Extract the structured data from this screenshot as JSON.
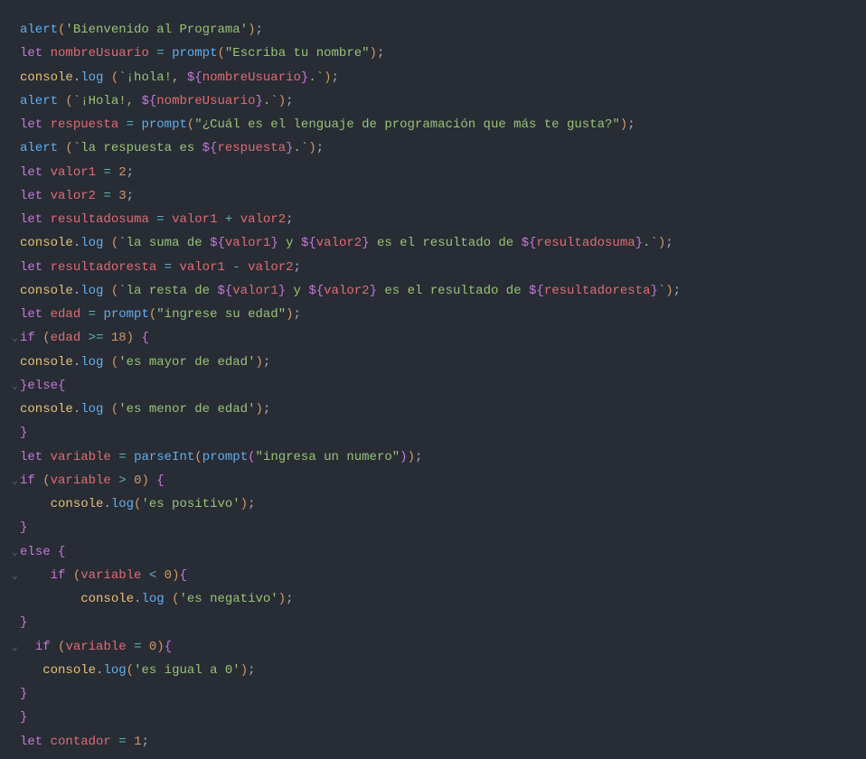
{
  "lines": [
    {
      "fold": "",
      "tokens": [
        [
          "fn",
          "alert"
        ],
        [
          "paren1",
          "("
        ],
        [
          "str",
          "'Bienvenido al Programa'"
        ],
        [
          "paren1",
          ")"
        ],
        [
          "punc",
          ";"
        ]
      ]
    },
    {
      "fold": "",
      "tokens": [
        [
          "kw",
          "let"
        ],
        [
          "default",
          " "
        ],
        [
          "var",
          "nombreUsuario"
        ],
        [
          "default",
          " "
        ],
        [
          "op",
          "="
        ],
        [
          "default",
          " "
        ],
        [
          "fn",
          "prompt"
        ],
        [
          "paren1",
          "("
        ],
        [
          "str",
          "\"Escriba tu nombre\""
        ],
        [
          "paren1",
          ")"
        ],
        [
          "punc",
          ";"
        ]
      ]
    },
    {
      "fold": "",
      "tokens": [
        [
          "obj",
          "console"
        ],
        [
          "punc",
          "."
        ],
        [
          "fn",
          "log"
        ],
        [
          "default",
          " "
        ],
        [
          "paren1",
          "("
        ],
        [
          "tpl",
          "`¡hola!, "
        ],
        [
          "brace",
          "${"
        ],
        [
          "int",
          "nombreUsuario"
        ],
        [
          "brace",
          "}"
        ],
        [
          "tpl",
          ".`"
        ],
        [
          "paren1",
          ")"
        ],
        [
          "punc",
          ";"
        ]
      ]
    },
    {
      "fold": "",
      "tokens": [
        [
          "fn",
          "alert"
        ],
        [
          "default",
          " "
        ],
        [
          "paren1",
          "("
        ],
        [
          "tpl",
          "`¡Hola!, "
        ],
        [
          "brace",
          "${"
        ],
        [
          "int",
          "nombreUsuario"
        ],
        [
          "brace",
          "}"
        ],
        [
          "tpl",
          ".`"
        ],
        [
          "paren1",
          ")"
        ],
        [
          "punc",
          ";"
        ]
      ]
    },
    {
      "fold": "",
      "tokens": [
        [
          "kw",
          "let"
        ],
        [
          "default",
          " "
        ],
        [
          "var",
          "respuesta"
        ],
        [
          "default",
          " "
        ],
        [
          "op",
          "="
        ],
        [
          "default",
          " "
        ],
        [
          "fn",
          "prompt"
        ],
        [
          "paren1",
          "("
        ],
        [
          "str",
          "\"¿Cuál es el lenguaje de programación que más te gusta?\""
        ],
        [
          "paren1",
          ")"
        ],
        [
          "punc",
          ";"
        ]
      ]
    },
    {
      "fold": "",
      "tokens": [
        [
          "fn",
          "alert"
        ],
        [
          "default",
          " "
        ],
        [
          "paren1",
          "("
        ],
        [
          "tpl",
          "`la respuesta es "
        ],
        [
          "brace",
          "${"
        ],
        [
          "int",
          "respuesta"
        ],
        [
          "brace",
          "}"
        ],
        [
          "tpl",
          ".`"
        ],
        [
          "paren1",
          ")"
        ],
        [
          "punc",
          ";"
        ]
      ]
    },
    {
      "fold": "",
      "tokens": [
        [
          "kw",
          "let"
        ],
        [
          "default",
          " "
        ],
        [
          "var",
          "valor1"
        ],
        [
          "default",
          " "
        ],
        [
          "op",
          "="
        ],
        [
          "default",
          " "
        ],
        [
          "num",
          "2"
        ],
        [
          "punc",
          ";"
        ]
      ]
    },
    {
      "fold": "",
      "tokens": [
        [
          "kw",
          "let"
        ],
        [
          "default",
          " "
        ],
        [
          "var",
          "valor2"
        ],
        [
          "default",
          " "
        ],
        [
          "op",
          "="
        ],
        [
          "default",
          " "
        ],
        [
          "num",
          "3"
        ],
        [
          "punc",
          ";"
        ]
      ]
    },
    {
      "fold": "",
      "tokens": [
        [
          "kw",
          "let"
        ],
        [
          "default",
          " "
        ],
        [
          "var",
          "resultadosuma"
        ],
        [
          "default",
          " "
        ],
        [
          "op",
          "="
        ],
        [
          "default",
          " "
        ],
        [
          "var",
          "valor1"
        ],
        [
          "default",
          " "
        ],
        [
          "op",
          "+"
        ],
        [
          "default",
          " "
        ],
        [
          "var",
          "valor2"
        ],
        [
          "punc",
          ";"
        ]
      ]
    },
    {
      "fold": "",
      "tokens": [
        [
          "obj",
          "console"
        ],
        [
          "punc",
          "."
        ],
        [
          "fn",
          "log"
        ],
        [
          "default",
          " "
        ],
        [
          "paren1",
          "("
        ],
        [
          "tpl",
          "`la suma de "
        ],
        [
          "brace",
          "${"
        ],
        [
          "int",
          "valor1"
        ],
        [
          "brace",
          "}"
        ],
        [
          "tpl",
          " y "
        ],
        [
          "brace",
          "${"
        ],
        [
          "int",
          "valor2"
        ],
        [
          "brace",
          "}"
        ],
        [
          "tpl",
          " es el resultado de "
        ],
        [
          "brace",
          "${"
        ],
        [
          "int",
          "resultadosuma"
        ],
        [
          "brace",
          "}"
        ],
        [
          "tpl",
          ".`"
        ],
        [
          "paren1",
          ")"
        ],
        [
          "punc",
          ";"
        ]
      ]
    },
    {
      "fold": "",
      "tokens": [
        [
          "kw",
          "let"
        ],
        [
          "default",
          " "
        ],
        [
          "var",
          "resultadoresta"
        ],
        [
          "default",
          " "
        ],
        [
          "op",
          "="
        ],
        [
          "default",
          " "
        ],
        [
          "var",
          "valor1"
        ],
        [
          "default",
          " "
        ],
        [
          "op",
          "-"
        ],
        [
          "default",
          " "
        ],
        [
          "var",
          "valor2"
        ],
        [
          "punc",
          ";"
        ]
      ]
    },
    {
      "fold": "",
      "tokens": [
        [
          "obj",
          "console"
        ],
        [
          "punc",
          "."
        ],
        [
          "fn",
          "log"
        ],
        [
          "default",
          " "
        ],
        [
          "paren1",
          "("
        ],
        [
          "tpl",
          "`la resta de "
        ],
        [
          "brace",
          "${"
        ],
        [
          "int",
          "valor1"
        ],
        [
          "brace",
          "}"
        ],
        [
          "tpl",
          " y "
        ],
        [
          "brace",
          "${"
        ],
        [
          "int",
          "valor2"
        ],
        [
          "brace",
          "}"
        ],
        [
          "tpl",
          " es el resultado de "
        ],
        [
          "brace",
          "${"
        ],
        [
          "int",
          "resultadoresta"
        ],
        [
          "brace",
          "}"
        ],
        [
          "tpl",
          "`"
        ],
        [
          "paren1",
          ")"
        ],
        [
          "punc",
          ";"
        ]
      ]
    },
    {
      "fold": "",
      "tokens": [
        [
          "kw",
          "let"
        ],
        [
          "default",
          " "
        ],
        [
          "var",
          "edad"
        ],
        [
          "default",
          " "
        ],
        [
          "op",
          "="
        ],
        [
          "default",
          " "
        ],
        [
          "fn",
          "prompt"
        ],
        [
          "paren1",
          "("
        ],
        [
          "str",
          "\"ingrese su edad\""
        ],
        [
          "paren1",
          ")"
        ],
        [
          "punc",
          ";"
        ]
      ]
    },
    {
      "fold": "v",
      "tokens": [
        [
          "kw",
          "if"
        ],
        [
          "default",
          " "
        ],
        [
          "paren1",
          "("
        ],
        [
          "var",
          "edad"
        ],
        [
          "default",
          " "
        ],
        [
          "op",
          ">="
        ],
        [
          "default",
          " "
        ],
        [
          "num",
          "18"
        ],
        [
          "paren1",
          ")"
        ],
        [
          "default",
          " "
        ],
        [
          "brace",
          "{"
        ]
      ]
    },
    {
      "fold": "",
      "tokens": [
        [
          "obj",
          "console"
        ],
        [
          "punc",
          "."
        ],
        [
          "fn",
          "log"
        ],
        [
          "default",
          " "
        ],
        [
          "paren1",
          "("
        ],
        [
          "str",
          "'es mayor de edad'"
        ],
        [
          "paren1",
          ")"
        ],
        [
          "punc",
          ";"
        ]
      ]
    },
    {
      "fold": "v",
      "tokens": [
        [
          "brace",
          "}"
        ],
        [
          "kw",
          "else"
        ],
        [
          "brace",
          "{"
        ]
      ]
    },
    {
      "fold": "",
      "tokens": [
        [
          "obj",
          "console"
        ],
        [
          "punc",
          "."
        ],
        [
          "fn",
          "log"
        ],
        [
          "default",
          " "
        ],
        [
          "paren1",
          "("
        ],
        [
          "str",
          "'es menor de edad'"
        ],
        [
          "paren1",
          ")"
        ],
        [
          "punc",
          ";"
        ]
      ]
    },
    {
      "fold": "",
      "tokens": [
        [
          "brace",
          "}"
        ]
      ]
    },
    {
      "fold": "",
      "tokens": [
        [
          "kw",
          "let"
        ],
        [
          "default",
          " "
        ],
        [
          "var",
          "variable"
        ],
        [
          "default",
          " "
        ],
        [
          "op",
          "="
        ],
        [
          "default",
          " "
        ],
        [
          "fn",
          "parseInt"
        ],
        [
          "paren1",
          "("
        ],
        [
          "fn",
          "prompt"
        ],
        [
          "paren2",
          "("
        ],
        [
          "str",
          "\"ingresa un numero\""
        ],
        [
          "paren2",
          ")"
        ],
        [
          "paren1",
          ")"
        ],
        [
          "punc",
          ";"
        ]
      ]
    },
    {
      "fold": "v",
      "tokens": [
        [
          "kw",
          "if"
        ],
        [
          "default",
          " "
        ],
        [
          "paren1",
          "("
        ],
        [
          "var",
          "variable"
        ],
        [
          "default",
          " "
        ],
        [
          "op",
          ">"
        ],
        [
          "default",
          " "
        ],
        [
          "num",
          "0"
        ],
        [
          "paren1",
          ")"
        ],
        [
          "default",
          " "
        ],
        [
          "brace",
          "{"
        ]
      ]
    },
    {
      "fold": "",
      "tokens": [
        [
          "default",
          "    "
        ],
        [
          "obj",
          "console"
        ],
        [
          "punc",
          "."
        ],
        [
          "fn",
          "log"
        ],
        [
          "paren1",
          "("
        ],
        [
          "str",
          "'es positivo'"
        ],
        [
          "paren1",
          ")"
        ],
        [
          "punc",
          ";"
        ]
      ]
    },
    {
      "fold": "",
      "tokens": [
        [
          "brace",
          "}"
        ]
      ]
    },
    {
      "fold": "v",
      "tokens": [
        [
          "kw",
          "else"
        ],
        [
          "default",
          " "
        ],
        [
          "brace",
          "{"
        ]
      ]
    },
    {
      "fold": "v",
      "tokens": [
        [
          "default",
          "    "
        ],
        [
          "kw",
          "if"
        ],
        [
          "default",
          " "
        ],
        [
          "paren1",
          "("
        ],
        [
          "var",
          "variable"
        ],
        [
          "default",
          " "
        ],
        [
          "op",
          "<"
        ],
        [
          "default",
          " "
        ],
        [
          "num",
          "0"
        ],
        [
          "paren1",
          ")"
        ],
        [
          "paren2",
          "{"
        ]
      ]
    },
    {
      "fold": "",
      "tokens": [
        [
          "default",
          "        "
        ],
        [
          "obj",
          "console"
        ],
        [
          "punc",
          "."
        ],
        [
          "fn",
          "log"
        ],
        [
          "default",
          " "
        ],
        [
          "paren1",
          "("
        ],
        [
          "str",
          "'es negativo'"
        ],
        [
          "paren1",
          ")"
        ],
        [
          "punc",
          ";"
        ]
      ]
    },
    {
      "fold": "",
      "tokens": [
        [
          "brace",
          "}"
        ]
      ]
    },
    {
      "fold": "v",
      "tokens": [
        [
          "default",
          "  "
        ],
        [
          "kw",
          "if"
        ],
        [
          "default",
          " "
        ],
        [
          "paren1",
          "("
        ],
        [
          "var",
          "variable"
        ],
        [
          "default",
          " "
        ],
        [
          "op",
          "="
        ],
        [
          "default",
          " "
        ],
        [
          "num",
          "0"
        ],
        [
          "paren1",
          ")"
        ],
        [
          "paren2",
          "{"
        ]
      ]
    },
    {
      "fold": "",
      "tokens": [
        [
          "default",
          "   "
        ],
        [
          "obj",
          "console"
        ],
        [
          "punc",
          "."
        ],
        [
          "fn",
          "log"
        ],
        [
          "paren1",
          "("
        ],
        [
          "str",
          "'es igual a 0'"
        ],
        [
          "paren1",
          ")"
        ],
        [
          "punc",
          ";"
        ]
      ]
    },
    {
      "fold": "",
      "tokens": [
        [
          "brace",
          "}"
        ]
      ]
    },
    {
      "fold": "",
      "tokens": [
        [
          "brace",
          "}"
        ]
      ]
    },
    {
      "fold": "",
      "tokens": [
        [
          "kw",
          "let"
        ],
        [
          "default",
          " "
        ],
        [
          "var",
          "contador"
        ],
        [
          "default",
          " "
        ],
        [
          "op",
          "="
        ],
        [
          "default",
          " "
        ],
        [
          "num",
          "1"
        ],
        [
          "punc",
          ";"
        ]
      ]
    }
  ]
}
